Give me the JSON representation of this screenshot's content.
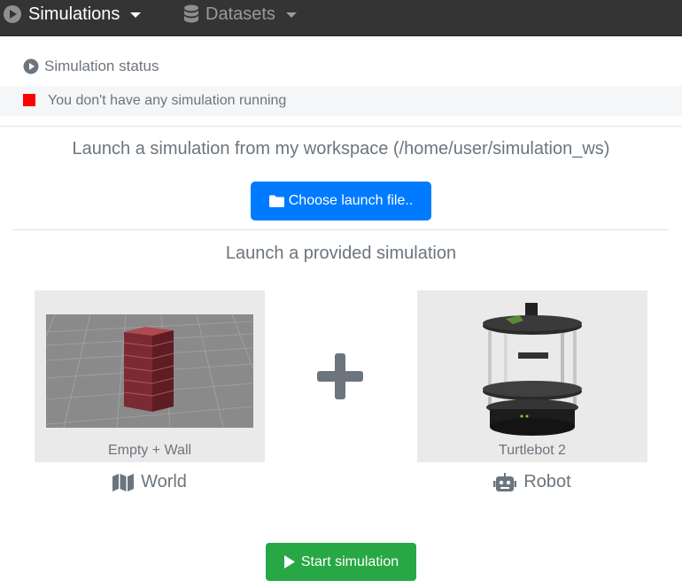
{
  "nav": {
    "simulations": "Simulations",
    "datasets": "Datasets"
  },
  "status": {
    "heading": "Simulation status",
    "message": "You don't have any simulation running",
    "indicator_color": "#ff0000"
  },
  "workspace": {
    "title": "Launch a simulation from my workspace (/home/user/simulation_ws)",
    "choose_button": "Choose launch file.."
  },
  "provided": {
    "title": "Launch a provided simulation",
    "world_caption": "Empty + Wall",
    "world_label": "World",
    "robot_caption": "Turtlebot 2",
    "robot_label": "Robot"
  },
  "actions": {
    "start_button": "Start simulation"
  },
  "colors": {
    "primary": "#007bff",
    "success": "#28a745",
    "navbar": "#343434"
  },
  "icons": {
    "simulations": "play-circle-icon",
    "datasets": "database-icon",
    "status": "play-circle-icon",
    "choose": "folder-icon",
    "world": "map-icon",
    "robot": "robot-icon",
    "combine": "plus-icon",
    "start": "play-icon"
  }
}
